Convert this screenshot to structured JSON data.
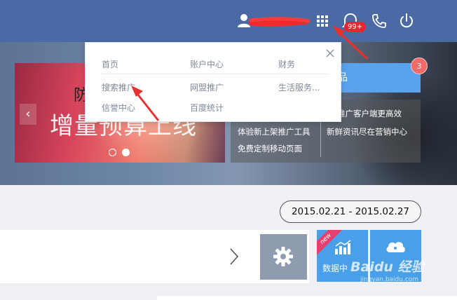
{
  "topbar": {
    "user_name": "",
    "notification_count": "99+",
    "icons": [
      "user-icon",
      "apps-grid-icon",
      "bell-icon",
      "phone-icon",
      "power-icon"
    ]
  },
  "dropdown": {
    "row1": [
      "首页",
      "账户中心",
      "财务"
    ],
    "row2": [
      "搜索推广",
      "网盟推广",
      "生活服务..."
    ],
    "row3": [
      "信誉中心",
      "百度统计"
    ]
  },
  "hero": {
    "banner_title_small": "防",
    "banner_title": "增量预算上线",
    "product_label": "品",
    "product_badge": "3",
    "news": {
      "left": [
        "体验新上架推广工具",
        "免费定制移动页面"
      ],
      "right": [
        "推广客户端更高效",
        "新鲜资讯尽在营销中心"
      ]
    },
    "prev_arrow": "‹",
    "slide_count": 2,
    "active_slide": 2
  },
  "report": {
    "date_range": "2015.02.21 - 2015.02.27"
  },
  "tiles": {
    "data_tile_label": "数据中",
    "data_tile_badge": "new",
    "cloud_tile_label": ""
  },
  "watermark": {
    "brand": "Baidu 经验",
    "url": "jingyan.baidu.com"
  },
  "colors": {
    "topbar": "#4a6aa6",
    "tile_blue": "#4aa0e8",
    "gear_tile": "#8f9cb0",
    "badge_red": "#e8262f",
    "annotation_red": "#e8312f"
  }
}
